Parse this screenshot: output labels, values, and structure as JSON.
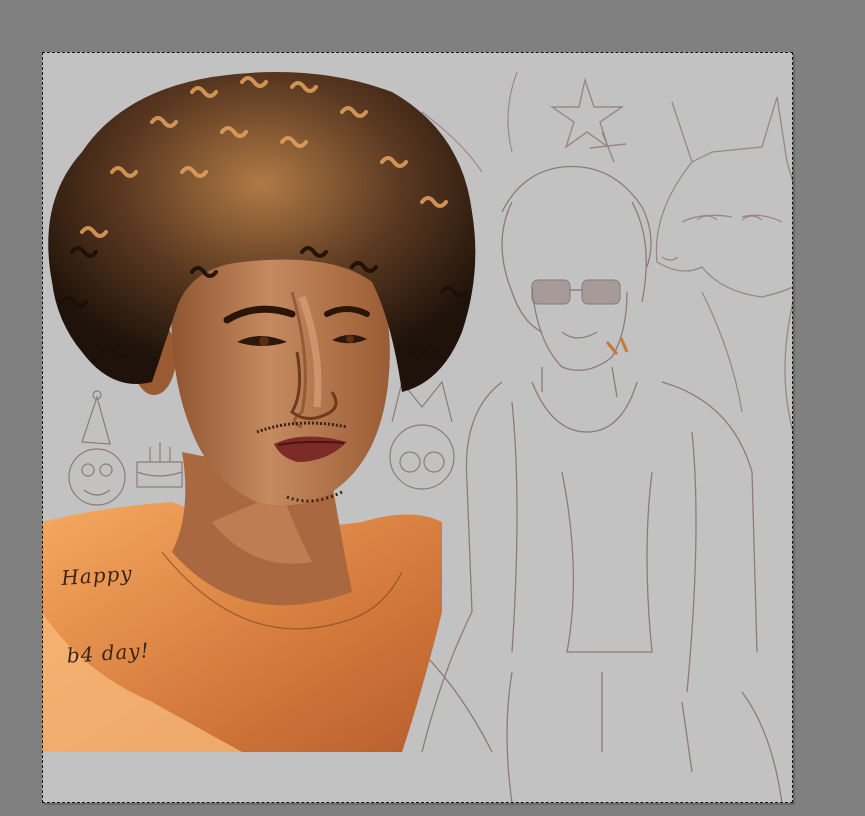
{
  "app": {
    "workspace_bg": "#808080",
    "canvas_bg": "#c2c2c2"
  },
  "artwork": {
    "caption_line1": "Happy",
    "caption_line2": "b4 day!",
    "palette": {
      "skin": "#b77a52",
      "skin_light": "#d9a27d",
      "hair_dark": "#2a1a10",
      "hair_light": "#e4a25f",
      "shirt": "#f39b4f",
      "shirt_shadow": "#c96a32",
      "sketch_line": "#8a7370"
    },
    "elements": [
      "star-icon",
      "sparkle-icon",
      "sunglasses-icon",
      "fox-sketch",
      "party-hat-icon",
      "cake-icon"
    ]
  }
}
